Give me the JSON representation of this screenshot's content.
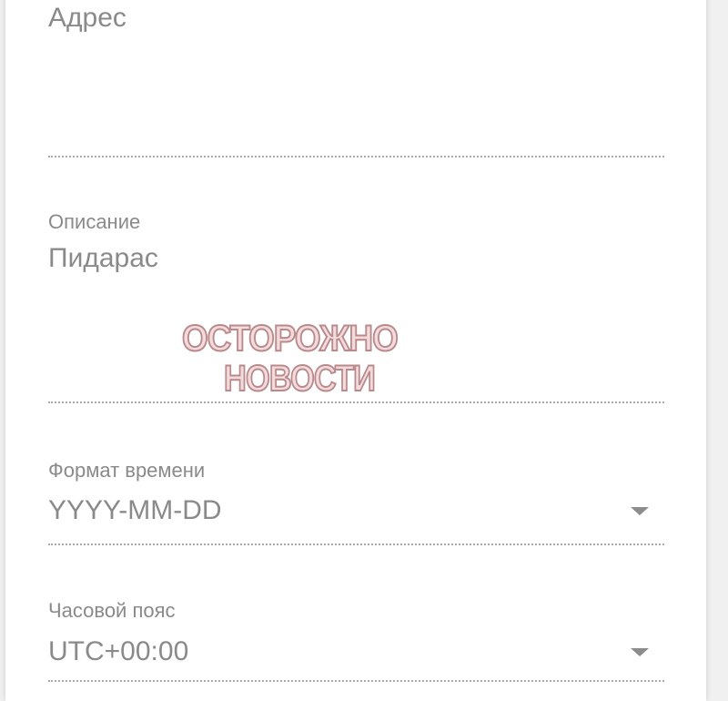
{
  "form": {
    "address": {
      "label": "Адрес"
    },
    "description": {
      "label": "Описание",
      "value": "Пидарас"
    },
    "time_format": {
      "label": "Формат времени",
      "value": "YYYY-MM-DD",
      "icon": "dropdown-arrow-icon"
    },
    "timezone": {
      "label": "Часовой пояс",
      "value": "UTC+00:00",
      "icon": "dropdown-arrow-icon"
    }
  },
  "watermark": {
    "line1": "ОСТОРОЖНО",
    "line2": "НОВОСТИ"
  },
  "colors": {
    "text": "#8a8a8a",
    "underline": "#a9a9a9",
    "watermark_fill": "#f2d6d8",
    "watermark_stroke": "#b88a8c",
    "background": "#f0f0f0",
    "card": "#ffffff"
  }
}
